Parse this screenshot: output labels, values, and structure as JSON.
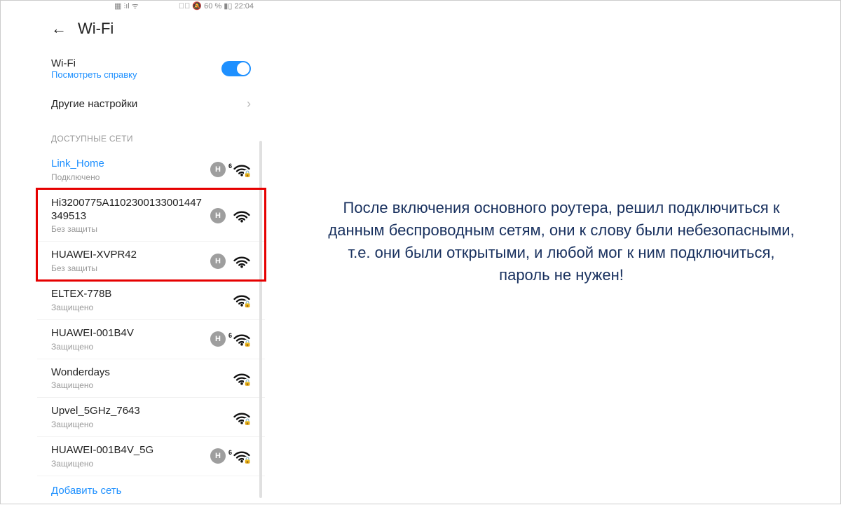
{
  "status_bar": {
    "left_icons": "▦ ⫶ıl ᯤ",
    "right": "✱⃠ 🔕 60 % ▮▯ 22:04"
  },
  "header": {
    "title": "Wi-Fi"
  },
  "wifi_toggle": {
    "label": "Wi-Fi",
    "help": "Посмотреть справку",
    "on": true
  },
  "other_settings": {
    "label": "Другие настройки"
  },
  "section_title": "ДОСТУПНЫЕ СЕТИ",
  "networks": [
    {
      "ssid": "Link_Home",
      "status": "Подключено",
      "connected": true,
      "h": true,
      "six": true,
      "lock": true
    },
    {
      "ssid": "Hi3200775A1102300133001447349513",
      "status": "Без защиты",
      "connected": false,
      "h": true,
      "six": false,
      "lock": false
    },
    {
      "ssid": "HUAWEI-XVPR42",
      "status": "Без защиты",
      "connected": false,
      "h": true,
      "six": false,
      "lock": false
    },
    {
      "ssid": "ELTEX-778B",
      "status": "Защищено",
      "connected": false,
      "h": false,
      "six": false,
      "lock": true
    },
    {
      "ssid": "HUAWEI-001B4V",
      "status": "Защищено",
      "connected": false,
      "h": true,
      "six": true,
      "lock": true
    },
    {
      "ssid": "Wonderdays",
      "status": "Защищено",
      "connected": false,
      "h": false,
      "six": false,
      "lock": true
    },
    {
      "ssid": "Upvel_5GHz_7643",
      "status": "Защищено",
      "connected": false,
      "h": false,
      "six": false,
      "lock": true
    },
    {
      "ssid": "HUAWEI-001B4V_5G",
      "status": "Защищено",
      "connected": false,
      "h": true,
      "six": true,
      "lock": true
    }
  ],
  "add_network": "Добавить сеть",
  "highlight": {
    "start_index": 1,
    "end_index": 2
  },
  "annotation": "После включения основного роутера, решил подключиться к данным беспроводным сетям, они к слову были небезопасными, т.е. они были открытыми, и любой мог к ним подключиться, пароль не нужен!"
}
